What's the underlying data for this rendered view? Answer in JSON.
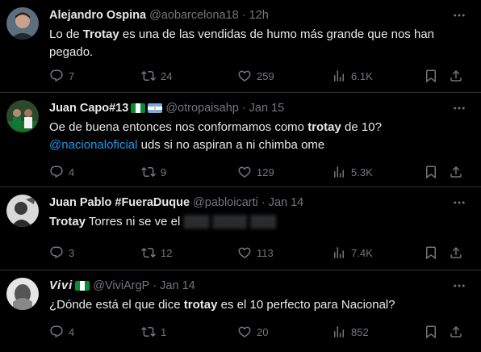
{
  "tweets": [
    {
      "name": "Alejandro Ospina",
      "handle": "@aobarcelona18",
      "time": "12h",
      "text": [
        {
          "t": "Lo de "
        },
        {
          "t": "Trotay",
          "b": true
        },
        {
          "t": " es una de las vendidas de humo más grande que nos han pegado."
        }
      ],
      "replies": "7",
      "retweets": "24",
      "likes": "259",
      "views": "6.1K"
    },
    {
      "name": "Juan Capo#13",
      "handle": "@otropaisahp",
      "time": "Jan 15",
      "flags": [
        "nigeria-flag",
        "argentina-flag"
      ],
      "text_line1": [
        {
          "t": "Oe de buena entonces nos conformamos como "
        },
        {
          "t": "trotay",
          "b": true
        },
        {
          "t": " de 10?"
        }
      ],
      "mention": "@nacionaloficial",
      "text_line2_rest": " uds si no aspiran a ni chimba ome",
      "replies": "4",
      "retweets": "9",
      "likes": "129",
      "views": "5.3K"
    },
    {
      "name": "Juan Pablo #FueraDuque",
      "handle": "@pabloicarti",
      "time": "Jan 14",
      "text_bold": "Trotay",
      "text_rest": " Torres ni se ve el",
      "replies": "3",
      "retweets": "12",
      "likes": "113",
      "views": "7.4K"
    },
    {
      "name": "Vivi",
      "handle": "@ViviArgP",
      "time": "Jan 14",
      "flags": [
        "nigeria-flag"
      ],
      "text": [
        {
          "t": "¿Dónde está el que dice "
        },
        {
          "t": "trotay",
          "b": true
        },
        {
          "t": " es el 10 perfecto para Nacional?"
        }
      ],
      "replies": "4",
      "retweets": "1",
      "likes": "20",
      "views": "852"
    }
  ],
  "colors": {
    "background": "#000000",
    "text": "#e7e9ea",
    "muted": "#71767b",
    "link": "#1d9bf0",
    "divider": "#2f3336"
  }
}
